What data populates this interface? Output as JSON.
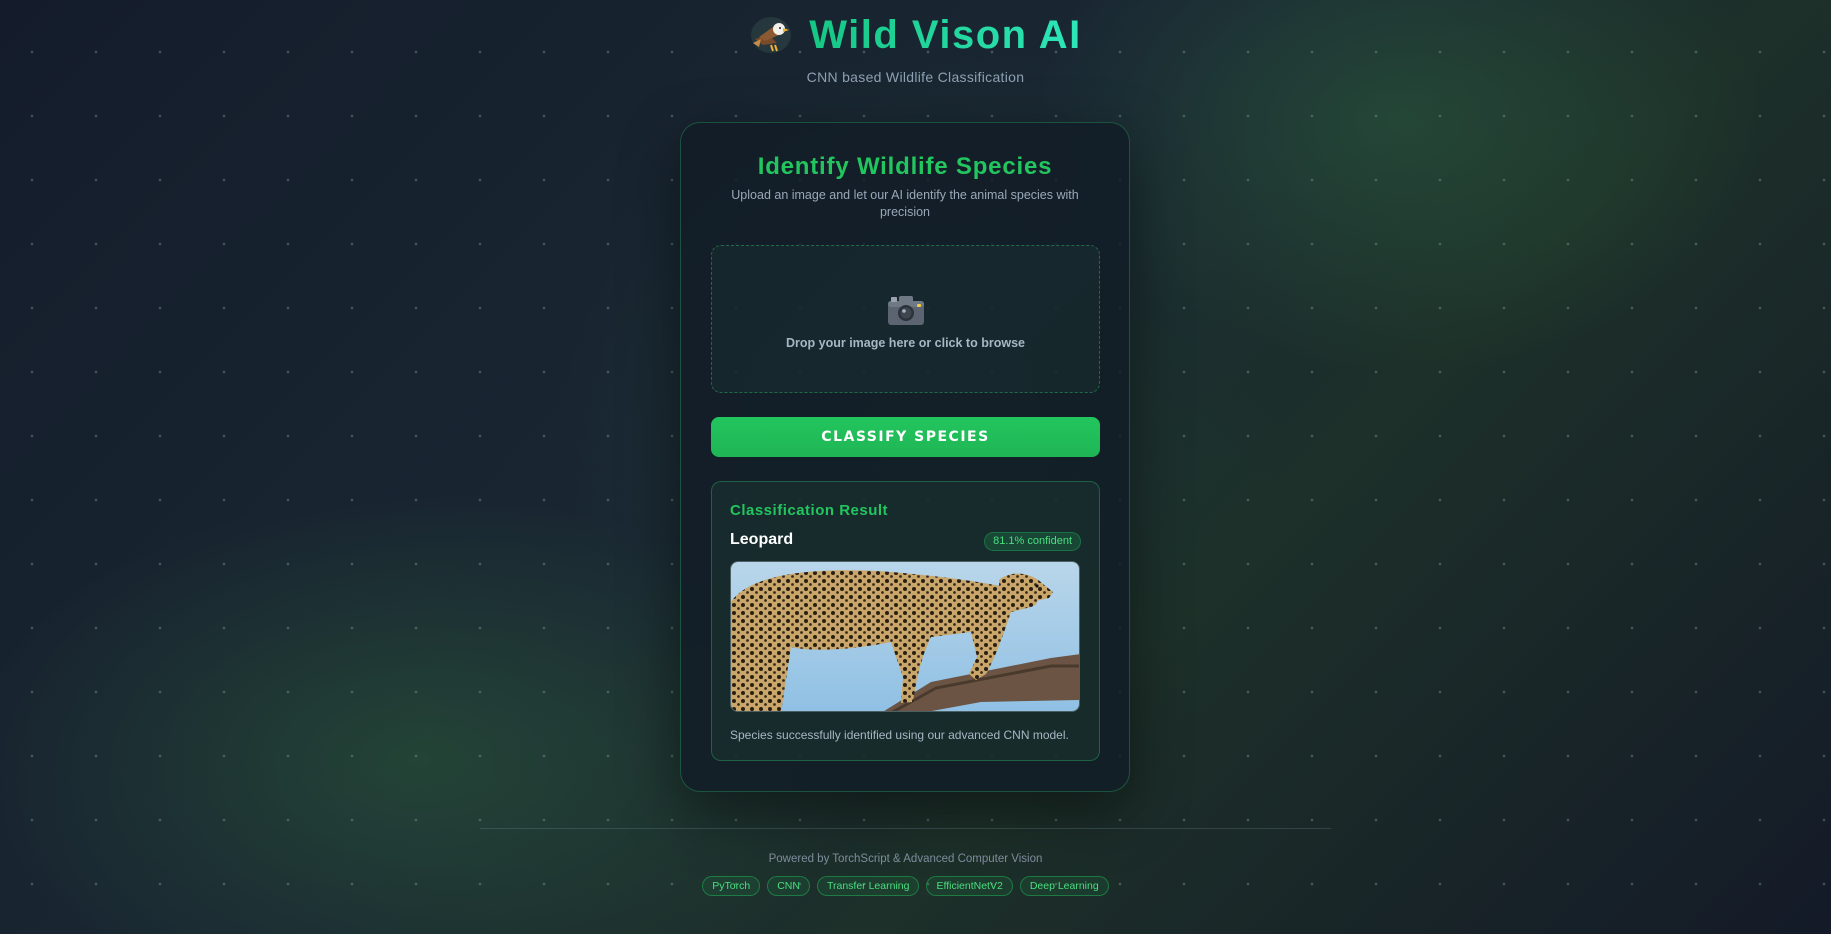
{
  "header": {
    "title": "Wild Vison AI",
    "subtitle": "CNN based Wildlife Classification",
    "logo_icon": "eagle-icon"
  },
  "card": {
    "title": "Identify Wildlife Species",
    "subtitle": "Upload an image and let our AI identify the animal species with precision",
    "dropzone": {
      "icon": "camera-icon",
      "text": "Drop your image here or click to browse"
    },
    "classify_button": "CLASSIFY SPECIES"
  },
  "result": {
    "heading": "Classification Result",
    "species": "Leopard",
    "confidence": "81.1% confident",
    "description": "Species successfully identified using our advanced CNN model."
  },
  "footer": {
    "powered_by": "Powered by TorchScript & Advanced Computer Vision",
    "tags": [
      "PyTorch",
      "CNN",
      "Transfer Learning",
      "EfficientNetV2",
      "Deep Learning"
    ]
  },
  "colors": {
    "accent": "#22c55e",
    "title_gradient_start": "#16c784",
    "title_gradient_end": "#2ee6b8"
  }
}
